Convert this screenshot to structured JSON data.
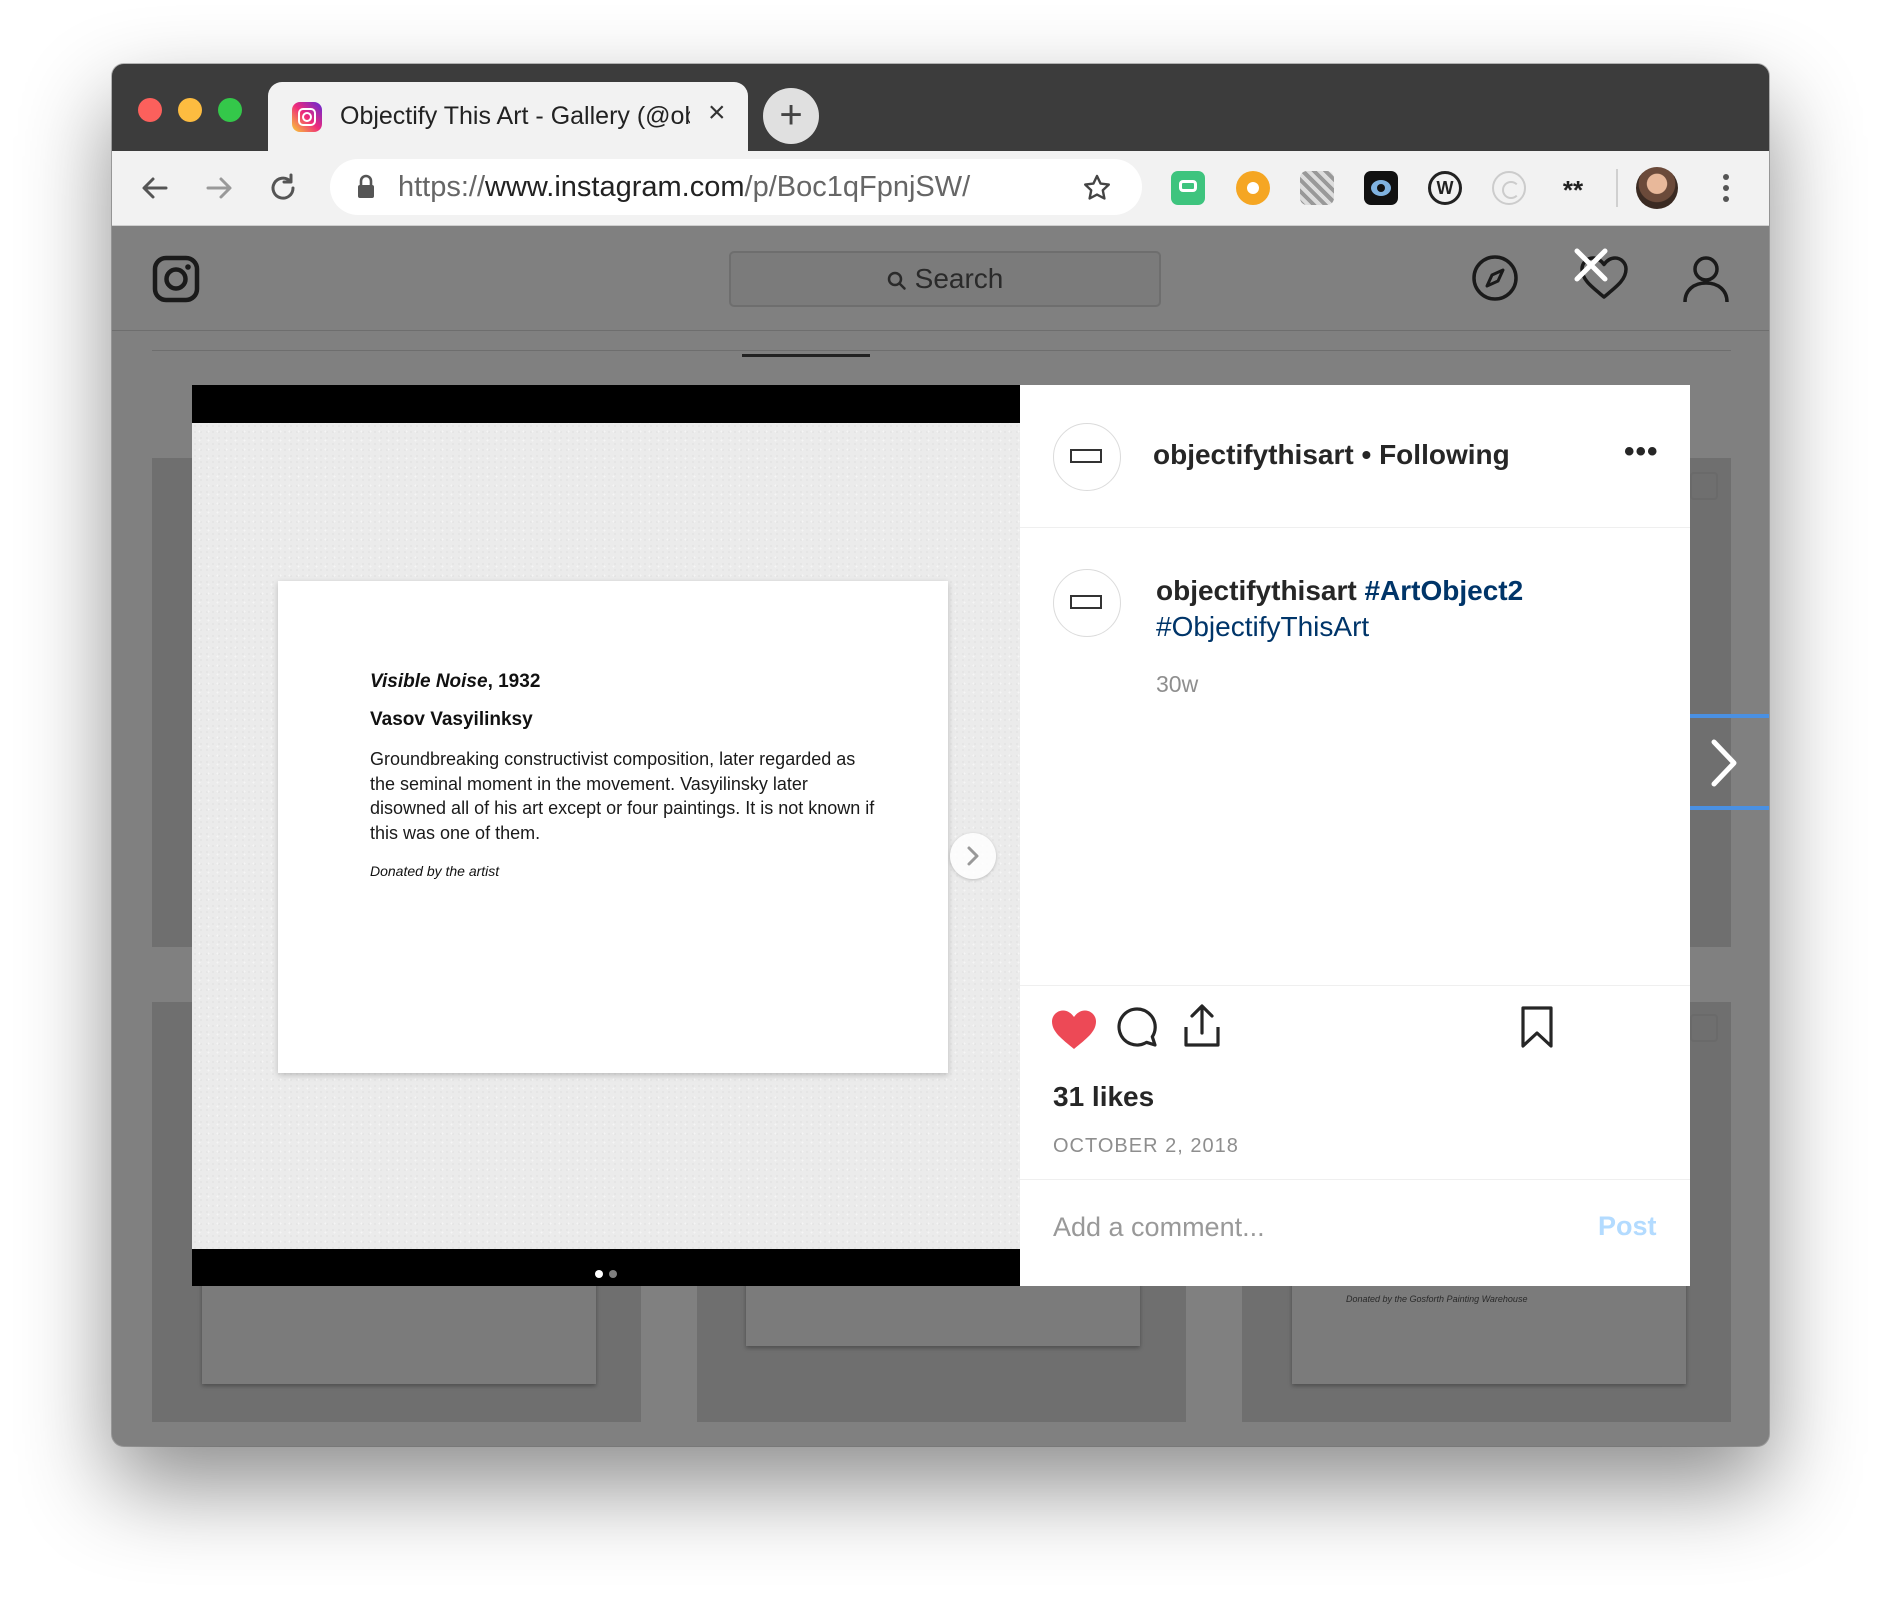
{
  "browser": {
    "tab_title": "Objectify This Art - Gallery (@objectifythisart)",
    "tab_close": "×",
    "new_tab": "+",
    "url_prefix": "https://",
    "url_host": "www.instagram.com",
    "url_path": "/p/Boc1qFpnjSW/",
    "extensions": [
      "chat-extension-icon",
      "gear-extension-icon",
      "pattern-extension-icon",
      "eye-extension-icon",
      "w-extension-icon",
      "swirl-extension-icon",
      "asterisk-extension-icon"
    ]
  },
  "ig_header": {
    "search_placeholder": "Search"
  },
  "post": {
    "media": {
      "art_title": "Visible Noise",
      "art_year": ", 1932",
      "artist": "Vasov Vasyilinksy",
      "description": "Groundbreaking constructivist composition, later regarded as the seminal moment in the movement. Vasyilinsky later disowned all of his art except or four paintings. It is not known if this was one of them.",
      "credit": "Donated by the artist",
      "slide_count": 2,
      "active_slide": 1
    },
    "username": "objectifythisart",
    "follow_separator": "•",
    "follow_status": "Following",
    "more_label": "•••",
    "caption_user": "objectifythisart",
    "hashtags": [
      "#ArtObject2",
      "#ObjectifyThisArt"
    ],
    "age": "30w",
    "liked": true,
    "likes": "31 likes",
    "date": "OCTOBER 2, 2018",
    "comment_placeholder": "Add a comment...",
    "post_label": "Post"
  },
  "background_grid": {
    "credit_text": "Donated by the Gosforth Painting Warehouse"
  },
  "colors": {
    "like_red": "#ed4956",
    "hashtag_blue": "#003569",
    "post_disabled": "#b3dbff"
  }
}
